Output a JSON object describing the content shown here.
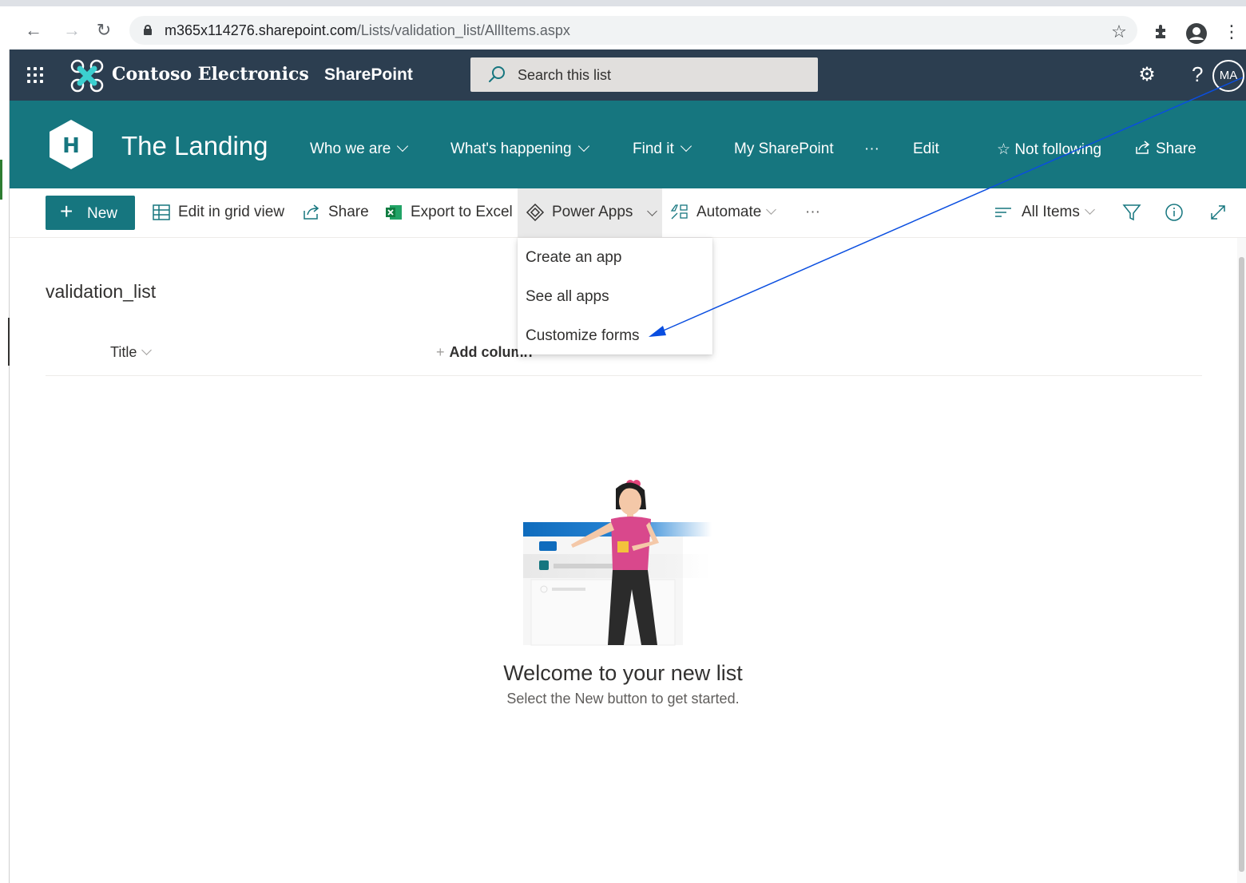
{
  "browser": {
    "url_host": "m365x114276.sharepoint.com",
    "url_path": "/Lists/validation_list/AllItems.aspx"
  },
  "suite": {
    "brand": "Contoso Electronics",
    "app": "SharePoint",
    "search_placeholder": "Search this list",
    "avatar_initials": "MA",
    "help_glyph": "?"
  },
  "site": {
    "logo_letter": "H",
    "title": "The Landing",
    "nav": [
      {
        "label": "Who we are",
        "dropdown": true
      },
      {
        "label": "What's happening",
        "dropdown": true
      },
      {
        "label": "Find it",
        "dropdown": true
      },
      {
        "label": "My SharePoint",
        "dropdown": false
      },
      {
        "label": "···",
        "dropdown": false
      },
      {
        "label": "Edit",
        "dropdown": false
      }
    ],
    "follow": "Not following",
    "share": "Share"
  },
  "commands": {
    "new": "New",
    "grid_view": "Edit in grid view",
    "share": "Share",
    "export": "Export to Excel",
    "power_apps": "Power Apps",
    "automate": "Automate",
    "more": "···",
    "view": "All Items"
  },
  "power_apps_menu": [
    "Create an app",
    "See all apps",
    "Customize forms"
  ],
  "list": {
    "title": "validation_list",
    "columns": [
      "Title",
      "Add column"
    ]
  },
  "empty_state": {
    "heading": "Welcome to your new list",
    "subtext": "Select the New button to get started."
  },
  "colors": {
    "suite_bar": "#2c3e50",
    "theme": "#16767f",
    "annotation_arrow": "#0a4ee0"
  }
}
